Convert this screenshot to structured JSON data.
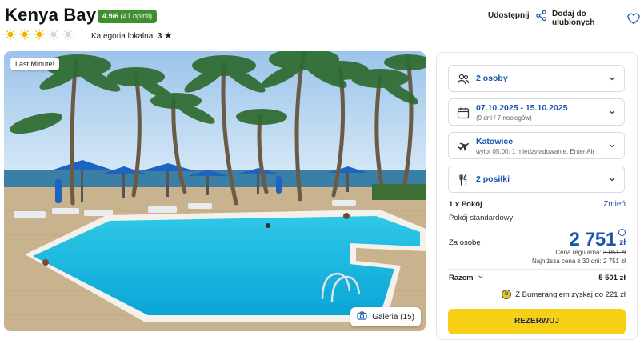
{
  "hotel": {
    "name": "Kenya Bay",
    "rating": "4.9/6",
    "reviews": "(41 opinii)",
    "category_label": "Kategoria lokalna:",
    "category_value": "3",
    "sun_count": 3,
    "sun_total": 5
  },
  "actions": {
    "share_label": "Udostępnij",
    "favorite_label": "Dodaj do ulubionych"
  },
  "photo": {
    "badge": "Last Minute!",
    "gallery_label": "Galeria (15)"
  },
  "booking": {
    "guests": "2 osoby",
    "dates": "07.10.2025 - 15.10.2025",
    "dates_sub": "(9 dni / 7 noclegów)",
    "departure": "Katowice",
    "departure_sub": "wylot 05:00, 1 międzylądowanie, Enter Air",
    "meals": "2 posiłki",
    "rooms_label": "1 x Pokój",
    "change_label": "Zmień",
    "room_type": "Pokój standardowy",
    "per_person_label": "Za osobę",
    "price": "2 751",
    "currency": "zł",
    "regular_label": "Cena regularna:",
    "regular_price": "3 051 zł",
    "lowest_price_note": "Najniższa cena z 30 dni: 2 751 zł",
    "total_label": "Razem",
    "total_value": "5 501 zł",
    "bumerang_text": "Z Bumerangiem zyskaj do 221 zł",
    "reserve_label": "REZERWUJ"
  },
  "colors": {
    "accent_blue": "#1a56b0",
    "rating_green": "#3f8f2e",
    "cta_yellow": "#f7cf14",
    "sun_yellow": "#f5b400"
  }
}
